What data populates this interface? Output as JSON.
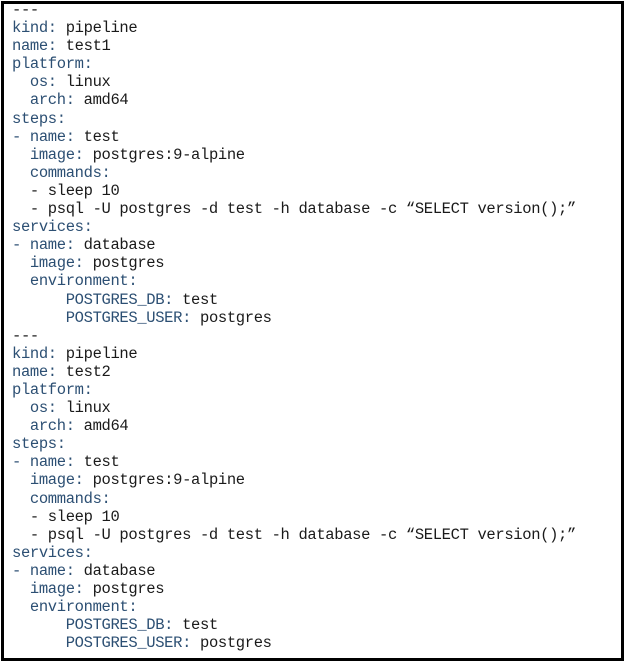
{
  "document": {
    "type": "yaml",
    "colors": {
      "key": "#2c4f73",
      "value": "#1a1a1a",
      "border": "#000000"
    },
    "lines": [
      {
        "indent": "",
        "dash": "",
        "key": "",
        "value": "---"
      },
      {
        "indent": "",
        "dash": "",
        "key": "kind:",
        "value": " pipeline"
      },
      {
        "indent": "",
        "dash": "",
        "key": "name:",
        "value": " test1"
      },
      {
        "indent": "",
        "dash": "",
        "key": "platform:",
        "value": ""
      },
      {
        "indent": "  ",
        "dash": "",
        "key": "os:",
        "value": " linux"
      },
      {
        "indent": "  ",
        "dash": "",
        "key": "arch:",
        "value": " amd64"
      },
      {
        "indent": "",
        "dash": "",
        "key": "steps:",
        "value": ""
      },
      {
        "indent": "",
        "dash": "- ",
        "key": "name:",
        "value": " test"
      },
      {
        "indent": "  ",
        "dash": "",
        "key": "image:",
        "value": " postgres:9-alpine"
      },
      {
        "indent": "  ",
        "dash": "",
        "key": "commands:",
        "value": ""
      },
      {
        "indent": "  ",
        "dash": "",
        "key": "",
        "value": "- sleep 10"
      },
      {
        "indent": "  ",
        "dash": "",
        "key": "",
        "value": "- psql -U postgres -d test -h database -c “SELECT version();”"
      },
      {
        "indent": "",
        "dash": "",
        "key": "services:",
        "value": ""
      },
      {
        "indent": "",
        "dash": "- ",
        "key": "name:",
        "value": " database"
      },
      {
        "indent": "  ",
        "dash": "",
        "key": "image:",
        "value": " postgres"
      },
      {
        "indent": "  ",
        "dash": "",
        "key": "environment:",
        "value": ""
      },
      {
        "indent": "      ",
        "dash": "",
        "key": "POSTGRES_DB:",
        "value": " test"
      },
      {
        "indent": "      ",
        "dash": "",
        "key": "POSTGRES_USER:",
        "value": " postgres"
      },
      {
        "indent": "",
        "dash": "",
        "key": "",
        "value": "---"
      },
      {
        "indent": "",
        "dash": "",
        "key": "kind:",
        "value": " pipeline"
      },
      {
        "indent": "",
        "dash": "",
        "key": "name:",
        "value": " test2"
      },
      {
        "indent": "",
        "dash": "",
        "key": "platform:",
        "value": ""
      },
      {
        "indent": "  ",
        "dash": "",
        "key": "os:",
        "value": " linux"
      },
      {
        "indent": "  ",
        "dash": "",
        "key": "arch:",
        "value": " amd64"
      },
      {
        "indent": "",
        "dash": "",
        "key": "steps:",
        "value": ""
      },
      {
        "indent": "",
        "dash": "- ",
        "key": "name:",
        "value": " test"
      },
      {
        "indent": "  ",
        "dash": "",
        "key": "image:",
        "value": " postgres:9-alpine"
      },
      {
        "indent": "  ",
        "dash": "",
        "key": "commands:",
        "value": ""
      },
      {
        "indent": "  ",
        "dash": "",
        "key": "",
        "value": "- sleep 10"
      },
      {
        "indent": "  ",
        "dash": "",
        "key": "",
        "value": "- psql -U postgres -d test -h database -c “SELECT version();”"
      },
      {
        "indent": "",
        "dash": "",
        "key": "services:",
        "value": ""
      },
      {
        "indent": "",
        "dash": "- ",
        "key": "name:",
        "value": " database"
      },
      {
        "indent": "  ",
        "dash": "",
        "key": "image:",
        "value": " postgres"
      },
      {
        "indent": "  ",
        "dash": "",
        "key": "environment:",
        "value": ""
      },
      {
        "indent": "      ",
        "dash": "",
        "key": "POSTGRES_DB:",
        "value": " test"
      },
      {
        "indent": "      ",
        "dash": "",
        "key": "POSTGRES_USER:",
        "value": " postgres"
      }
    ]
  }
}
